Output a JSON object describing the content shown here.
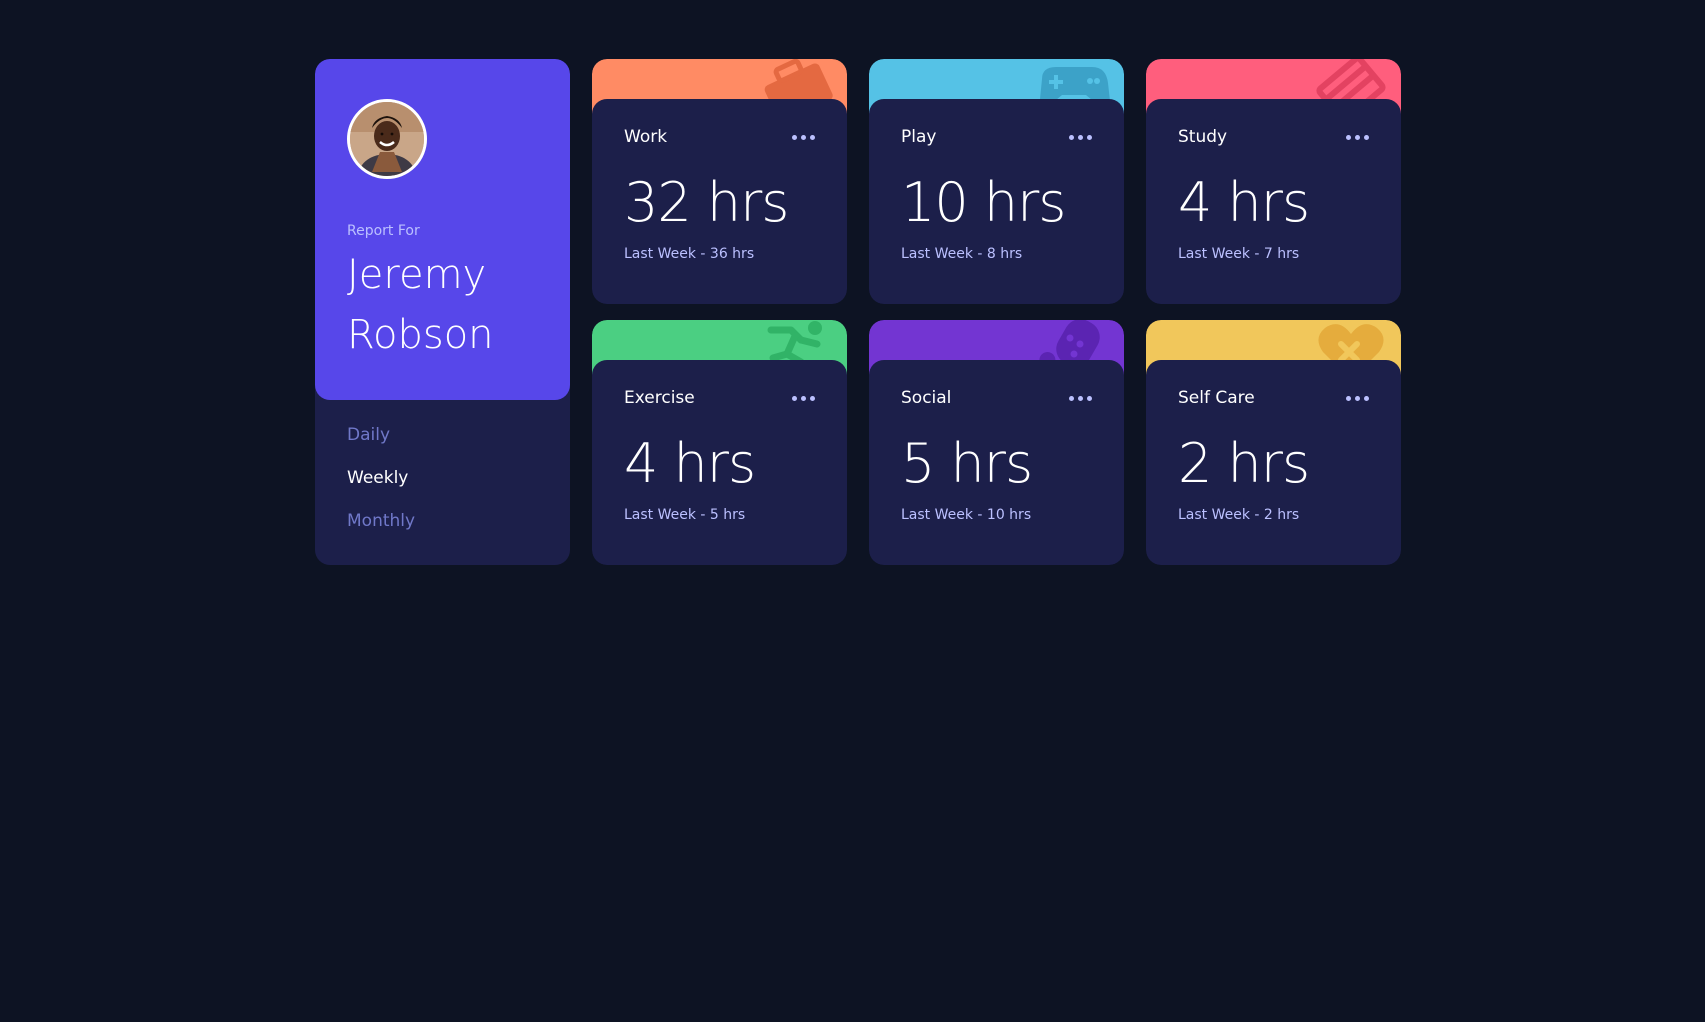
{
  "profile": {
    "report_label": "Report For",
    "name": "Jeremy Robson",
    "avatar_alt": "avatar"
  },
  "timeframes": [
    {
      "label": "Daily",
      "active": false
    },
    {
      "label": "Weekly",
      "active": true
    },
    {
      "label": "Monthly",
      "active": false
    }
  ],
  "activities": [
    {
      "title": "Work",
      "current": "32 hrs",
      "previous": "Last Week - 36 hrs",
      "color": "#ff8b64",
      "icon": "briefcase-icon"
    },
    {
      "title": "Play",
      "current": "10 hrs",
      "previous": "Last Week - 8 hrs",
      "color": "#55c2e6",
      "icon": "gamepad-icon"
    },
    {
      "title": "Study",
      "current": "4 hrs",
      "previous": "Last Week - 7 hrs",
      "color": "#ff5e7d",
      "icon": "book-icon"
    },
    {
      "title": "Exercise",
      "current": "4 hrs",
      "previous": "Last Week - 5 hrs",
      "color": "#4bcf82",
      "icon": "running-icon"
    },
    {
      "title": "Social",
      "current": "5 hrs",
      "previous": "Last Week - 10 hrs",
      "color": "#7335d2",
      "icon": "chat-icon"
    },
    {
      "title": "Self Care",
      "current": "2 hrs",
      "previous": "Last Week - 2 hrs",
      "color": "#f1c75b",
      "icon": "heart-icon"
    }
  ],
  "colors": {
    "background": "#0d1323",
    "card": "#1c1f4a",
    "profile": "#5747ea",
    "muted_text": "#bbc0ff",
    "inactive_link": "#7078c9"
  }
}
